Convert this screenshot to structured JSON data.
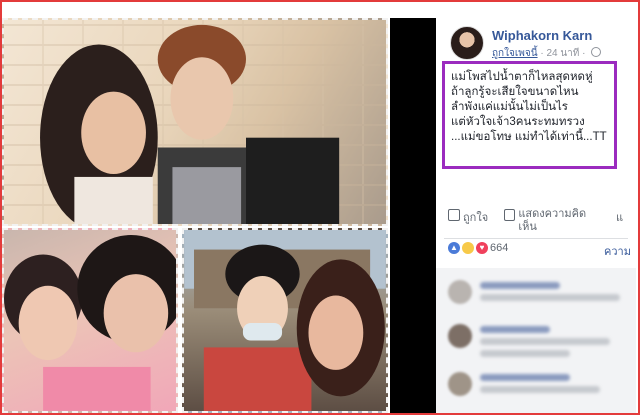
{
  "post": {
    "author": "Wiphakorn Karn",
    "meta_link": "ถูกใจเพจนี้",
    "meta_time": " · 24 นาที · ",
    "text": "แม่โพสไปน้ำตาก็ไหลสุดหดหู่\nถ้าลูกรู้จะเสียใจขนาดไหน\nลำพังแค่แม่นั้นไม่เป็นไร\nแต่หัวใจเจ้า3คนระทมทรวง\n...แม่ขอโทษ แม่ทำได้เท่านี้...TT"
  },
  "actions": {
    "like": "ถูกใจ",
    "comment": "แสดงความคิดเห็น",
    "share": "แ"
  },
  "reactions": {
    "count": "664",
    "more": "ความ"
  },
  "icons": {
    "avatar": "profile-photo",
    "globe": "globe-icon",
    "like": "thumbs-up-icon",
    "comment": "comment-bubble-icon"
  },
  "colors": {
    "highlight_box": "#9b2bbf",
    "link_blue": "#365899",
    "outer_frame": "#e33b3b"
  }
}
